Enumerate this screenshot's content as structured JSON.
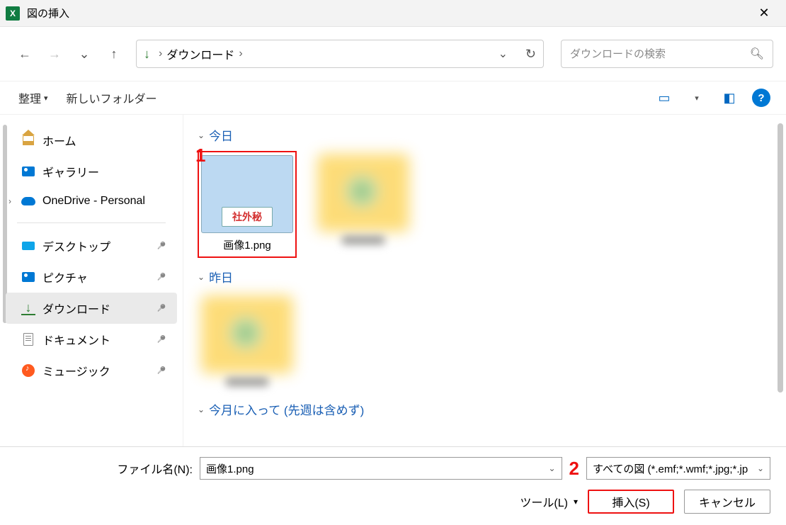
{
  "title": "図の挿入",
  "nav": {
    "crumb1": "ダウンロード"
  },
  "search": {
    "placeholder": "ダウンロードの検索"
  },
  "toolbar": {
    "organize": "整理",
    "newfolder": "新しいフォルダー"
  },
  "sidebar": {
    "home": "ホーム",
    "gallery": "ギャラリー",
    "onedrive": "OneDrive - Personal",
    "desktop": "デスクトップ",
    "pictures": "ピクチャ",
    "downloads": "ダウンロード",
    "documents": "ドキュメント",
    "music": "ミュージック"
  },
  "groups": {
    "today": "今日",
    "yesterday": "昨日",
    "earlier": "今月に入って (先週は含めず)"
  },
  "file1": {
    "stamp": "社外秘",
    "name": "画像1.png"
  },
  "bottom": {
    "filename_label": "ファイル名(N):",
    "filename_value": "画像1.png",
    "filetype": "すべての図 (*.emf;*.wmf;*.jpg;*.jp",
    "tools": "ツール(L)",
    "insert": "挿入(S)",
    "cancel": "キャンセル"
  },
  "annot": {
    "one": "1",
    "two": "2"
  }
}
